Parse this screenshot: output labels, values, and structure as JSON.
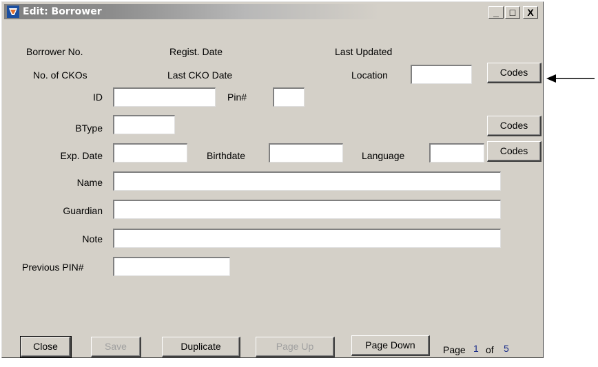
{
  "window": {
    "title": "Edit: Borrower",
    "minimize": "_",
    "maximize": "□",
    "close": "X"
  },
  "labels": {
    "borrower_no": "Borrower No.",
    "regist_date": "Regist. Date",
    "last_updated": "Last Updated",
    "num_ckos": "No. of CKOs",
    "last_cko_date": "Last CKO Date",
    "location": "Location",
    "id": "ID",
    "pin": "Pin#",
    "btype": "BType",
    "exp_date": "Exp. Date",
    "birthdate": "Birthdate",
    "language": "Language",
    "name": "Name",
    "guardian": "Guardian",
    "note": "Note",
    "previous_pin": "Previous PIN#"
  },
  "fields": {
    "location": "",
    "id": "",
    "pin": "",
    "btype": "",
    "exp_date": "",
    "birthdate": "",
    "language": "",
    "name": "",
    "guardian": "",
    "note": "",
    "previous_pin": ""
  },
  "buttons": {
    "codes": "Codes",
    "close": "Close",
    "save": "Save",
    "duplicate": "Duplicate",
    "page_up": "Page Up",
    "page_down": "Page Down"
  },
  "pager": {
    "page_label": "Page",
    "current": "1",
    "of_label": "of",
    "total": "5"
  },
  "colors": {
    "page_number": "#1c2f8a",
    "window_bg": "#d4d0c8"
  }
}
